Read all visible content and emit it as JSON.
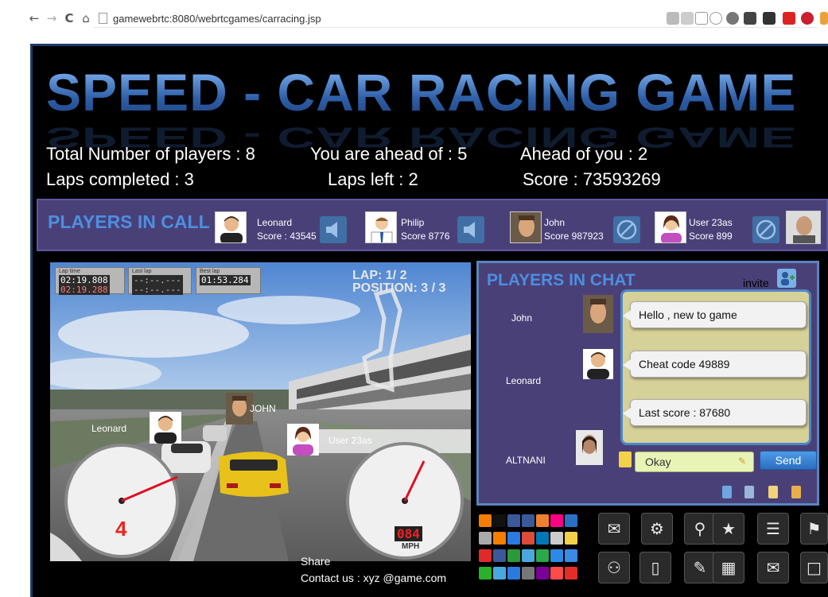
{
  "browser": {
    "back_icon": "back-arrow-icon",
    "forward_icon": "forward-arrow-icon",
    "reload_icon": "reload-icon",
    "home_icon": "home-icon",
    "url": "gamewebrtc:8080/webrtcgames/carracing.jsp"
  },
  "header": {
    "title": "SPEED - CAR RACING GAME"
  },
  "stats": {
    "total_players": "Total Number of players : 8",
    "ahead_of": "You are ahead of :  5",
    "ahead_of_you": "Ahead of you  : 2",
    "laps_completed": "Laps  completed  : 3",
    "laps_left": "Laps left : 2",
    "score": "Score : 73593269"
  },
  "call": {
    "title": "PLAYERS IN CALL",
    "players": [
      {
        "name": "Leonard",
        "score": "Score : 43545",
        "control_icon": "speaker-icon"
      },
      {
        "name": "Philip",
        "score": "Score 8776",
        "control_icon": "speaker-icon"
      },
      {
        "name": "John",
        "score": "Score 987923",
        "control_icon": "blocked-icon"
      },
      {
        "name": "User 23as",
        "score": "Score 899",
        "control_icon": "blocked-icon"
      }
    ]
  },
  "game": {
    "hud": [
      {
        "label": "Lap time",
        "value": "02:19.808",
        "value2": "02:19.288"
      },
      {
        "label": "Last lap",
        "value": "--:--.---",
        "value2": "--:--.---"
      },
      {
        "label": "Best lap",
        "value": "01:53.284",
        "value2": ""
      }
    ],
    "lap": "LAP: 1/ 2",
    "position": "POSITION: 3 / 3",
    "racers": [
      "Leonard",
      "JOHN",
      "User 23as"
    ],
    "speed": "084",
    "speed_unit": "MPH",
    "gear": "4"
  },
  "footer": {
    "share": "Share",
    "contact": "Contact us : xyz @game.com"
  },
  "chat": {
    "title": "PLAYERS IN CHAT",
    "invite": "invite",
    "users": [
      "John",
      "Leonard",
      "ALTNANI"
    ],
    "messages": [
      "Hello , new to game",
      "Cheat code 49889",
      "Last score : 87680"
    ],
    "input_value": "Okay",
    "send_label": "Send"
  },
  "colors": {
    "title_blue": "#3c78c4",
    "panel_purple": "#4a4078",
    "chat_bg": "#d6d099",
    "send_blue": "#2a6fc2"
  }
}
